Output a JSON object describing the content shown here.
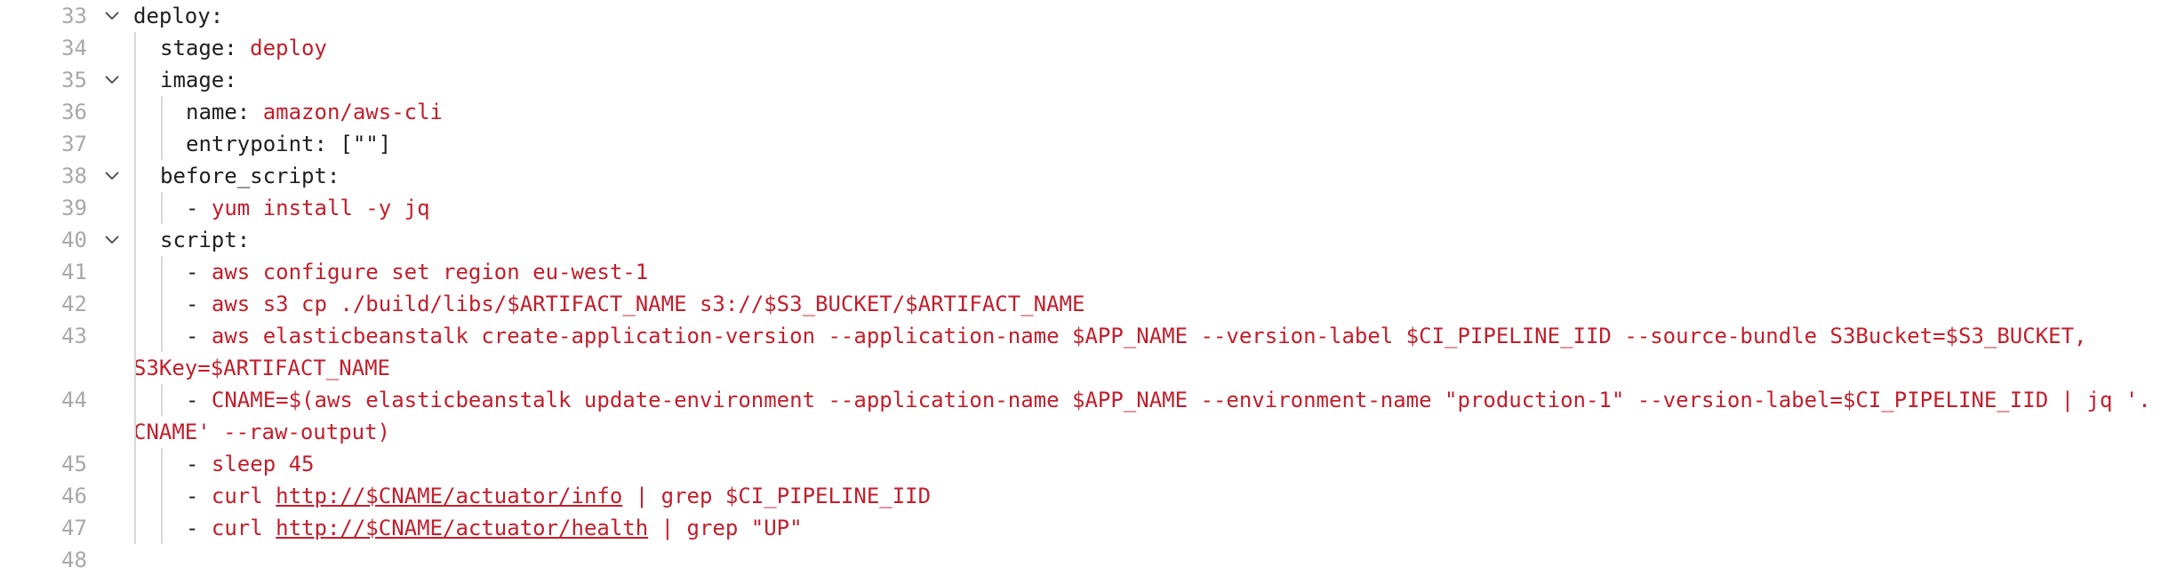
{
  "colors": {
    "key": "#1f1f1f",
    "string": "#c21e2b",
    "line_number": "#a8a8a8",
    "guide": "#d8d8d8"
  },
  "lines": [
    {
      "num": "33",
      "fold": true,
      "parts": [
        [
          "k",
          "deploy:"
        ]
      ]
    },
    {
      "num": "34",
      "fold": false,
      "parts": [
        [
          "k",
          "stage: "
        ],
        [
          "s",
          "deploy"
        ]
      ]
    },
    {
      "num": "35",
      "fold": true,
      "parts": [
        [
          "k",
          "image:"
        ]
      ]
    },
    {
      "num": "36",
      "fold": false,
      "parts": [
        [
          "k",
          "name: "
        ],
        [
          "s",
          "amazon/aws-cli"
        ]
      ]
    },
    {
      "num": "37",
      "fold": false,
      "parts": [
        [
          "k",
          "entrypoint: [\"\"]"
        ]
      ]
    },
    {
      "num": "38",
      "fold": true,
      "parts": [
        [
          "k",
          "before_script:"
        ]
      ]
    },
    {
      "num": "39",
      "fold": false,
      "parts": [
        [
          "k",
          "- "
        ],
        [
          "s",
          "yum install -y jq"
        ]
      ]
    },
    {
      "num": "40",
      "fold": true,
      "parts": [
        [
          "k",
          "script:"
        ]
      ]
    },
    {
      "num": "41",
      "fold": false,
      "parts": [
        [
          "k",
          "- "
        ],
        [
          "s",
          "aws configure set region eu-west-1"
        ]
      ]
    },
    {
      "num": "42",
      "fold": false,
      "parts": [
        [
          "k",
          "- "
        ],
        [
          "s",
          "aws s3 cp ./build/libs/$ARTIFACT_NAME s3://$S3_BUCKET/$ARTIFACT_NAME"
        ]
      ]
    },
    {
      "num": "43",
      "fold": false,
      "parts": [
        [
          "k",
          "- "
        ],
        [
          "s",
          "aws elasticbeanstalk create-application-version --application-name $APP_NAME --version-label $CI_PIPELINE_IID --source-bundle S3Bucket=$S3_BUCKET,"
        ]
      ]
    },
    {
      "num": "",
      "fold": false,
      "parts": [
        [
          "s",
          "S3Key=$ARTIFACT_NAME"
        ]
      ]
    },
    {
      "num": "44",
      "fold": false,
      "parts": [
        [
          "k",
          "- "
        ],
        [
          "s",
          "CNAME=$(aws elasticbeanstalk update-environment --application-name $APP_NAME --environment-name \"production-1\" --version-label=$CI_PIPELINE_IID | jq '."
        ]
      ]
    },
    {
      "num": "",
      "fold": false,
      "parts": [
        [
          "s",
          "CNAME' --raw-output)"
        ]
      ]
    },
    {
      "num": "45",
      "fold": false,
      "parts": [
        [
          "k",
          "- "
        ],
        [
          "s",
          "sleep 45"
        ]
      ]
    },
    {
      "num": "46",
      "fold": false,
      "parts": [
        [
          "k",
          "- "
        ],
        [
          "s",
          "curl "
        ],
        [
          "su",
          "http://$CNAME/actuator/info"
        ],
        [
          "s",
          " | grep $CI_PIPELINE_IID"
        ]
      ]
    },
    {
      "num": "47",
      "fold": false,
      "parts": [
        [
          "k",
          "- "
        ],
        [
          "s",
          "curl "
        ],
        [
          "su",
          "http://$CNAME/actuator/health"
        ],
        [
          "s",
          " | grep \"UP\""
        ]
      ]
    },
    {
      "num": "48",
      "fold": false,
      "parts": []
    }
  ]
}
